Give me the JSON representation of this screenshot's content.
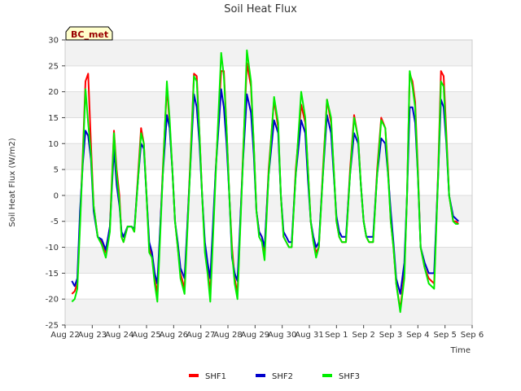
{
  "chart_data": {
    "type": "line",
    "title": "Soil Heat Flux",
    "xlabel": "Time",
    "ylabel": "Soil Heat Flux (W/m2)",
    "badge": "BC_met",
    "ylim": [
      -25,
      30
    ],
    "yticks": [
      -25,
      -20,
      -15,
      -10,
      -5,
      0,
      5,
      10,
      15,
      20,
      25,
      30
    ],
    "xlim": [
      0,
      15
    ],
    "xticks": [
      0,
      1,
      2,
      3,
      4,
      5,
      6,
      7,
      8,
      9,
      10,
      11,
      12,
      13,
      14,
      15
    ],
    "xtick_labels": [
      "Aug 22",
      "Aug 23",
      "Aug 24",
      "Aug 25",
      "Aug 26",
      "Aug 27",
      "Aug 28",
      "Aug 29",
      "Aug 30",
      "Aug 31",
      "Sep 1",
      "Sep 2",
      "Sep 3",
      "Sep 4",
      "Sep 5",
      "Sep 6"
    ],
    "grid": true,
    "legend_position": "bottom",
    "colors": {
      "SHF1": "#ff0000",
      "SHF2": "#0000cc",
      "SHF3": "#00ee00"
    },
    "series": [
      {
        "name": "SHF1",
        "x": [
          0.25,
          0.35,
          0.45,
          0.55,
          0.65,
          0.75,
          0.85,
          0.95,
          1.05,
          1.2,
          1.35,
          1.5,
          1.65,
          1.8,
          1.9,
          2.0,
          2.08,
          2.15,
          2.3,
          2.45,
          2.55,
          2.7,
          2.8,
          2.9,
          3.0,
          3.1,
          3.2,
          3.3,
          3.4,
          3.6,
          3.75,
          3.85,
          3.95,
          4.05,
          4.15,
          4.25,
          4.4,
          4.6,
          4.75,
          4.85,
          4.95,
          5.05,
          5.15,
          5.25,
          5.35,
          5.55,
          5.75,
          5.85,
          5.95,
          6.05,
          6.15,
          6.25,
          6.35,
          6.55,
          6.7,
          6.85,
          6.95,
          7.05,
          7.15,
          7.25,
          7.35,
          7.5,
          7.7,
          7.85,
          7.95,
          8.05,
          8.15,
          8.25,
          8.35,
          8.5,
          8.7,
          8.85,
          8.95,
          9.05,
          9.15,
          9.25,
          9.35,
          9.5,
          9.65,
          9.8,
          9.9,
          10.0,
          10.1,
          10.2,
          10.35,
          10.5,
          10.65,
          10.8,
          10.9,
          11.0,
          11.1,
          11.2,
          11.35,
          11.5,
          11.65,
          11.8,
          11.9,
          12.0,
          12.1,
          12.2,
          12.35,
          12.5,
          12.6,
          12.7,
          12.8,
          12.9,
          13.0,
          13.1,
          13.25,
          13.4,
          13.6,
          13.75,
          13.85,
          13.95,
          14.05,
          14.15,
          14.3,
          14.4,
          14.5
        ],
        "y": [
          -19,
          -18.5,
          -17,
          -5,
          8,
          22,
          23.5,
          10,
          -2,
          -8,
          -9,
          -11,
          -6,
          12.5,
          5,
          0,
          -8,
          -9,
          -6,
          -6,
          -7,
          5,
          13,
          10,
          0,
          -10,
          -12,
          -16,
          -19,
          5,
          21,
          14,
          5,
          -5,
          -10,
          -15,
          -18,
          5,
          23.5,
          23,
          12,
          0,
          -10,
          -14,
          -19,
          5,
          24,
          24,
          13,
          0,
          -10,
          -16,
          -19,
          7,
          25.5,
          21,
          10,
          -3,
          -7,
          -8,
          -11,
          5,
          18.5,
          13,
          0,
          -8,
          -9,
          -10,
          -10,
          5,
          17.5,
          14,
          5,
          -5,
          -9,
          -11,
          -10,
          5,
          18.5,
          14,
          5,
          -5,
          -8,
          -9,
          -9,
          5,
          15.5,
          11,
          2,
          -5,
          -8,
          -9,
          -9,
          5,
          15,
          13,
          5,
          -5,
          -10,
          -17,
          -22,
          -15,
          0,
          23.5,
          22,
          18,
          5,
          -10,
          -14,
          -16,
          -17,
          5,
          24,
          23,
          12,
          0,
          -5,
          -5,
          -5.5
        ]
      },
      {
        "name": "SHF2",
        "x": [
          0.25,
          0.35,
          0.45,
          0.55,
          0.65,
          0.75,
          0.85,
          0.95,
          1.05,
          1.2,
          1.35,
          1.5,
          1.65,
          1.8,
          1.9,
          2.0,
          2.08,
          2.15,
          2.3,
          2.45,
          2.55,
          2.7,
          2.8,
          2.9,
          3.0,
          3.1,
          3.2,
          3.3,
          3.4,
          3.6,
          3.75,
          3.85,
          3.95,
          4.05,
          4.15,
          4.25,
          4.4,
          4.6,
          4.75,
          4.85,
          4.95,
          5.05,
          5.15,
          5.25,
          5.35,
          5.55,
          5.75,
          5.85,
          5.95,
          6.05,
          6.15,
          6.25,
          6.35,
          6.55,
          6.7,
          6.85,
          6.95,
          7.05,
          7.15,
          7.25,
          7.35,
          7.5,
          7.7,
          7.85,
          7.95,
          8.05,
          8.15,
          8.25,
          8.35,
          8.5,
          8.7,
          8.85,
          8.95,
          9.05,
          9.15,
          9.25,
          9.35,
          9.5,
          9.65,
          9.8,
          9.9,
          10.0,
          10.1,
          10.2,
          10.35,
          10.5,
          10.65,
          10.8,
          10.9,
          11.0,
          11.1,
          11.2,
          11.35,
          11.5,
          11.65,
          11.8,
          11.9,
          12.0,
          12.1,
          12.2,
          12.35,
          12.5,
          12.6,
          12.7,
          12.8,
          12.9,
          13.0,
          13.1,
          13.25,
          13.4,
          13.6,
          13.75,
          13.85,
          13.95,
          14.05,
          14.15,
          14.3,
          14.4,
          14.5
        ],
        "y": [
          -16.5,
          -17.5,
          -16,
          -3,
          6,
          12.5,
          11.5,
          7,
          -3,
          -8,
          -8.5,
          -10.5,
          -6,
          9,
          2,
          -2,
          -7,
          -8,
          -6,
          -6,
          -6.5,
          4,
          10,
          9,
          0,
          -9,
          -11,
          -15,
          -17,
          4,
          15.5,
          13,
          5,
          -5,
          -9,
          -14,
          -16,
          4,
          19.5,
          17,
          10,
          0,
          -9,
          -13,
          -16,
          5,
          20.5,
          17,
          10,
          0,
          -12,
          -15,
          -16.5,
          6,
          19.5,
          16,
          8,
          -3,
          -7,
          -8,
          -10,
          4,
          14.5,
          12,
          0,
          -7,
          -8,
          -9,
          -9,
          4,
          14.5,
          12,
          3,
          -5,
          -8,
          -10,
          -9,
          4,
          15.5,
          12,
          4,
          -4,
          -7,
          -8,
          -8,
          4,
          12,
          10,
          2,
          -5,
          -8,
          -8,
          -8,
          4,
          11,
          10,
          4,
          -3,
          -9,
          -16,
          -19,
          -13,
          0,
          17,
          17,
          14,
          4,
          -10,
          -13,
          -15,
          -15,
          4,
          18.5,
          17,
          10,
          0,
          -4,
          -4.5,
          -5
        ]
      },
      {
        "name": "SHF3",
        "x": [
          0.25,
          0.35,
          0.45,
          0.55,
          0.65,
          0.75,
          0.85,
          0.95,
          1.05,
          1.2,
          1.35,
          1.5,
          1.65,
          1.8,
          1.9,
          2.0,
          2.08,
          2.15,
          2.3,
          2.45,
          2.55,
          2.7,
          2.8,
          2.9,
          3.0,
          3.1,
          3.2,
          3.3,
          3.4,
          3.6,
          3.75,
          3.85,
          3.95,
          4.05,
          4.15,
          4.25,
          4.4,
          4.6,
          4.75,
          4.85,
          4.95,
          5.05,
          5.15,
          5.25,
          5.35,
          5.55,
          5.75,
          5.85,
          5.95,
          6.05,
          6.15,
          6.25,
          6.35,
          6.55,
          6.7,
          6.85,
          6.95,
          7.05,
          7.15,
          7.25,
          7.35,
          7.5,
          7.7,
          7.85,
          7.95,
          8.05,
          8.15,
          8.25,
          8.35,
          8.5,
          8.7,
          8.85,
          8.95,
          9.05,
          9.15,
          9.25,
          9.35,
          9.5,
          9.65,
          9.8,
          9.9,
          10.0,
          10.1,
          10.2,
          10.35,
          10.5,
          10.65,
          10.8,
          10.9,
          11.0,
          11.1,
          11.2,
          11.35,
          11.5,
          11.65,
          11.8,
          11.9,
          12.0,
          12.1,
          12.2,
          12.35,
          12.5,
          12.6,
          12.7,
          12.8,
          12.9,
          13.0,
          13.1,
          13.25,
          13.4,
          13.6,
          13.75,
          13.85,
          13.95,
          14.05,
          14.15,
          14.3,
          14.4,
          14.5
        ],
        "y": [
          -20.5,
          -20,
          -18,
          -6,
          7,
          20.5,
          14,
          8,
          -2,
          -8,
          -9.5,
          -12,
          -7,
          12,
          4,
          -1,
          -8,
          -9,
          -6,
          -6,
          -7,
          4,
          12,
          10,
          0,
          -11,
          -12,
          -17,
          -20.5,
          4,
          22,
          15,
          5,
          -5,
          -10,
          -16,
          -19,
          4,
          23,
          22,
          12,
          0,
          -11,
          -15,
          -20.5,
          4,
          27.5,
          23,
          13,
          0,
          -11,
          -17,
          -20,
          6,
          28,
          22,
          10,
          -3,
          -8,
          -9,
          -12.5,
          4,
          19,
          14,
          0,
          -8,
          -9,
          -10,
          -10,
          4,
          20,
          15,
          5,
          -5,
          -9,
          -12,
          -10,
          4,
          18.5,
          15,
          5,
          -5,
          -8,
          -9,
          -9,
          4,
          15,
          11,
          2,
          -5,
          -8,
          -9,
          -9,
          4,
          14.5,
          13,
          4,
          -5,
          -10,
          -17,
          -22.5,
          -16,
          0,
          24,
          21,
          17,
          4,
          -10,
          -14,
          -17,
          -18,
          4,
          22,
          21,
          11,
          0,
          -5,
          -5.5,
          -5.5
        ]
      }
    ]
  }
}
